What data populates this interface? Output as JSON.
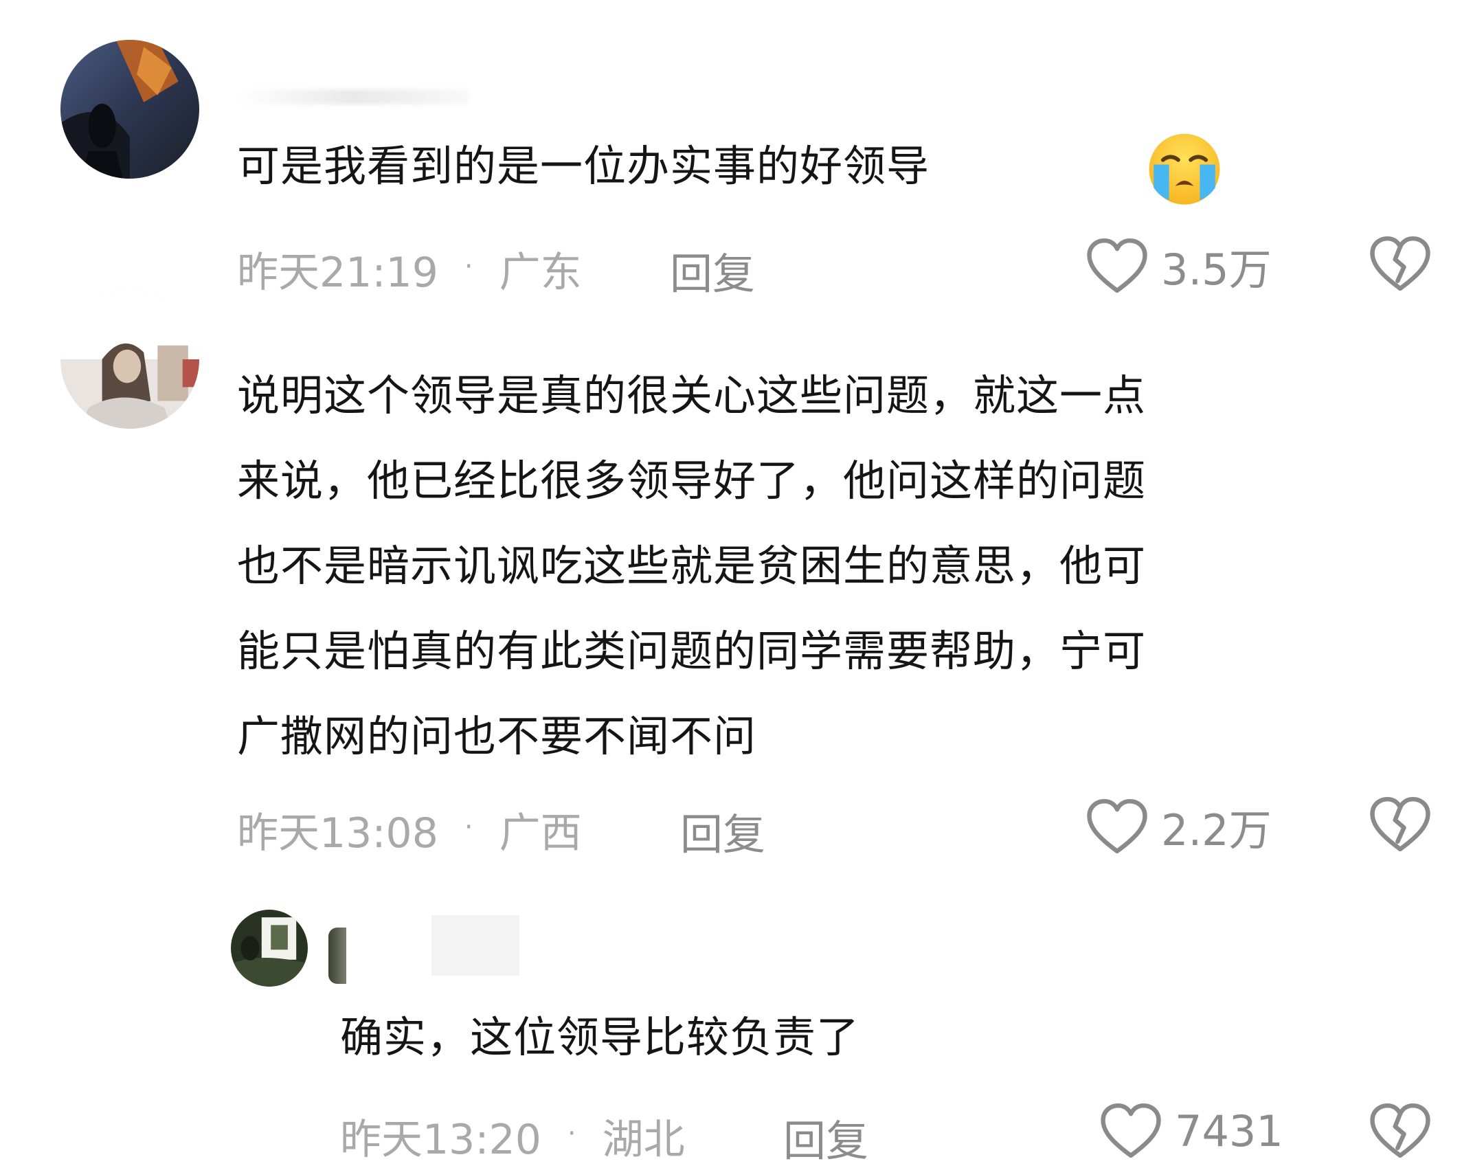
{
  "comments": [
    {
      "text_lines": [
        "可是我看到的是一位办实事的好领导"
      ],
      "emoji": "loudly-crying-face",
      "time": "昨天21:19",
      "separator": "·",
      "location": "广东",
      "reply_label": "回复",
      "like_count": "3.5万"
    },
    {
      "text_lines": [
        "说明这个领导是真的很关心这些问题，就这一点",
        "来说，他已经比很多领导好了，他问这样的问题",
        "也不是暗示讥讽吃这些就是贫困生的意思，他可",
        "能只是怕真的有此类问题的同学需要帮助，宁可",
        "广撒网的问也不要不闻不问"
      ],
      "time": "昨天13:08",
      "separator": "·",
      "location": "广西",
      "reply_label": "回复",
      "like_count": "2.2万"
    },
    {
      "text_lines": [
        "确实，这位领导比较负责了"
      ],
      "time": "昨天13:20",
      "separator": "·",
      "location": "湖北",
      "reply_label": "回复",
      "like_count": "7431"
    }
  ],
  "icons": {
    "like": "heart-outline-icon",
    "dislike": "broken-heart-outline-icon"
  },
  "colors": {
    "text": "#151515",
    "meta": "#a9a9a9",
    "action": "#8c8c8c",
    "icon_stroke": "#8a8a8a"
  }
}
